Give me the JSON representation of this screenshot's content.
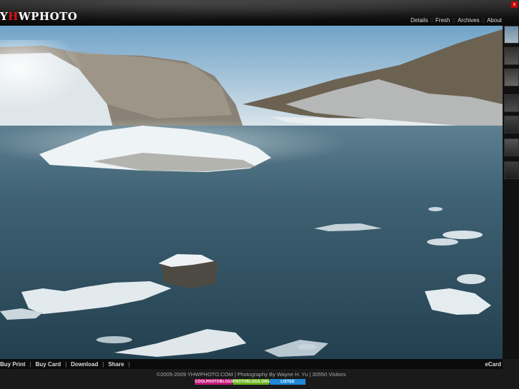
{
  "header": {
    "logo_prefix": "Y",
    "logo_highlight": "H",
    "logo_suffix": "WPHOTO",
    "nav": [
      "Details",
      "Fresh",
      "Archives",
      "About"
    ],
    "nav_separator": "::",
    "close_label": "x"
  },
  "actions": {
    "items": [
      "Buy Print",
      "Buy Card",
      "Download",
      "Share"
    ],
    "separator": "|",
    "trailing_separator": "|",
    "ecard": "eCard"
  },
  "footer": {
    "copyright": "©2005-2009 YHWPHOTO.COM | Photography By Wayne H. Yu | 30550 Visitors",
    "badges": [
      {
        "label": "COOLPHOTOBLOGS",
        "color": "#c2187a"
      },
      {
        "label": "PHOTOBLOGS.ORG",
        "color": "#6db31b"
      },
      {
        "label": "LISTED",
        "color": "#1e88d9"
      }
    ]
  },
  "colors": {
    "accent_red": "#d11",
    "background": "#1a1a1a"
  }
}
